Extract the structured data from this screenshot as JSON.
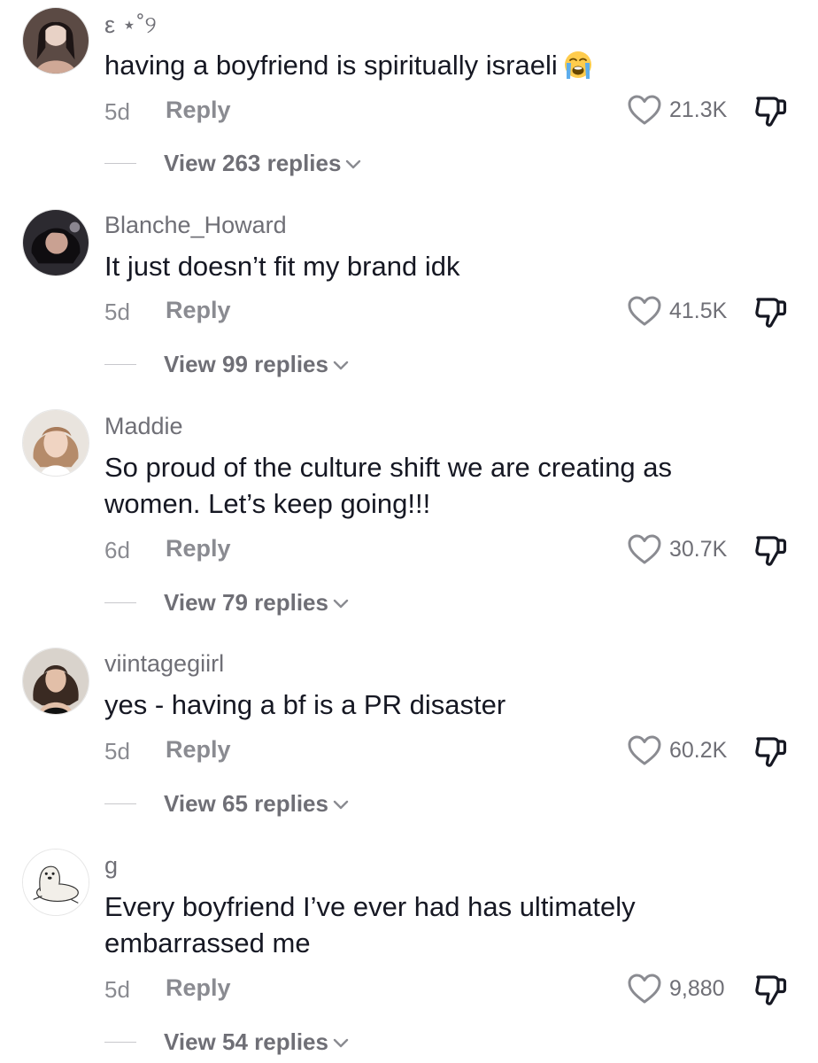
{
  "comments": [
    {
      "username": "ε ⋆˚୨",
      "text": "having a boyfriend is spiritually israeli",
      "emoji": "loudly-crying-face",
      "age": "5d",
      "reply_label": "Reply",
      "likes": "21.3K",
      "view_replies": "View 263 replies"
    },
    {
      "username": "Blanche_Howard",
      "text": "It just doesn’t fit my brand idk",
      "age": "5d",
      "reply_label": "Reply",
      "likes": "41.5K",
      "view_replies": "View 99 replies"
    },
    {
      "username": "Maddie",
      "text": "So proud of the culture shift we are creating as women. Let’s keep going!!!",
      "age": "6d",
      "reply_label": "Reply",
      "likes": "30.7K",
      "view_replies": "View 79 replies"
    },
    {
      "username": "viintagegiirl",
      "text": "yes - having a bf is a PR disaster",
      "age": "5d",
      "reply_label": "Reply",
      "likes": "60.2K",
      "view_replies": "View 65 replies"
    },
    {
      "username": "g",
      "text": "Every boyfriend I’ve ever had has ultimately embarrassed me",
      "age": "5d",
      "reply_label": "Reply",
      "likes": "9,880",
      "view_replies": "View 54 replies"
    }
  ],
  "icons": {
    "like": "heart-outline-icon",
    "dislike": "thumbs-down-outline-icon",
    "expand": "chevron-down-icon"
  },
  "colors": {
    "text": "#161823",
    "secondary": "#8a8b91",
    "username": "#6f6f76",
    "background": "#ffffff"
  }
}
